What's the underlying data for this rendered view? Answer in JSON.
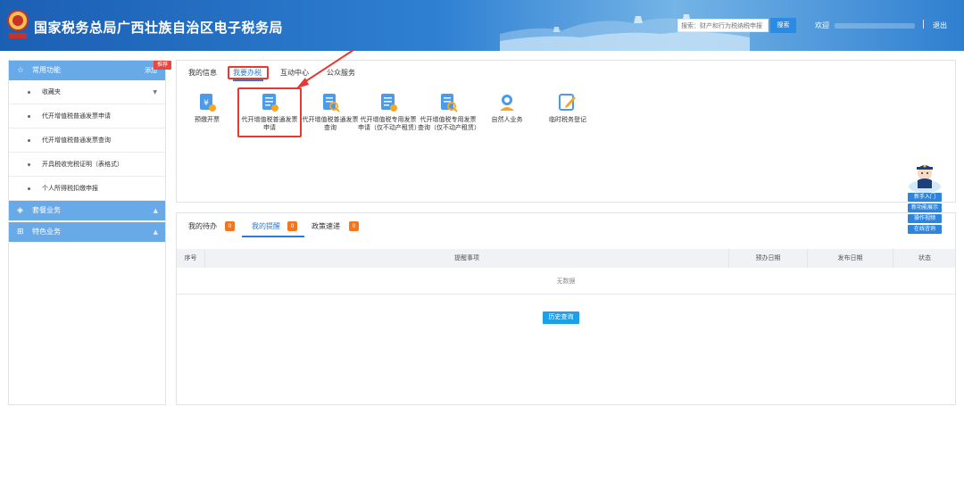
{
  "header": {
    "title": "国家税务总局广西壮族自治区电子税务局",
    "search_placeholder": "搜索：财产和行为税纳税申报",
    "search_button": "搜索",
    "welcome": "欢迎",
    "logout": "退出"
  },
  "sidebar": {
    "common_title": "常用功能",
    "add_label": "添加",
    "recommend_badge": "推荐",
    "items": [
      {
        "label": "收藏夹"
      },
      {
        "label": "代开增值税普通发票申请"
      },
      {
        "label": "代开增值税普通发票查询"
      },
      {
        "label": "开具税收完税证明（表格式）"
      },
      {
        "label": "个人所得税扣缴申报"
      }
    ],
    "section2": "套餐业务",
    "section3": "特色业务"
  },
  "top_tabs": [
    {
      "label": "我的信息"
    },
    {
      "label": "我要办税"
    },
    {
      "label": "互动中心"
    },
    {
      "label": "公众服务"
    }
  ],
  "functions": [
    {
      "label": "预缴开票",
      "icon": "invoice-yen-icon"
    },
    {
      "label": "代开增值税普通发票申请",
      "icon": "doc-list-icon"
    },
    {
      "label": "代开增值税普通发票查询",
      "icon": "doc-search-icon"
    },
    {
      "label": "代开增值税专用发票申请（仅不动产租赁）",
      "icon": "doc-list-icon"
    },
    {
      "label": "代开增值税专用发票查询（仅不动产租赁）",
      "icon": "doc-search-icon"
    },
    {
      "label": "自然人业务",
      "icon": "person-service-icon"
    },
    {
      "label": "临时税务登记",
      "icon": "edit-note-icon"
    }
  ],
  "bottom_tabs": [
    {
      "label": "我的待办",
      "count": "0"
    },
    {
      "label": "我的提醒",
      "count": "0"
    },
    {
      "label": "政策速递",
      "count": "0"
    }
  ],
  "table": {
    "headers": [
      "序号",
      "提醒事项",
      "预办日期",
      "发布日期",
      "状态"
    ],
    "empty_text": "无数据"
  },
  "history_button": "历史查询",
  "float_menu": [
    "新手入门",
    "新功能展示",
    "操作视频",
    "在线咨询"
  ],
  "colors": {
    "primary": "#2b7bd4",
    "sidebar_section": "#68a9e8",
    "highlight": "#e33a32",
    "badge": "#f2761e"
  }
}
